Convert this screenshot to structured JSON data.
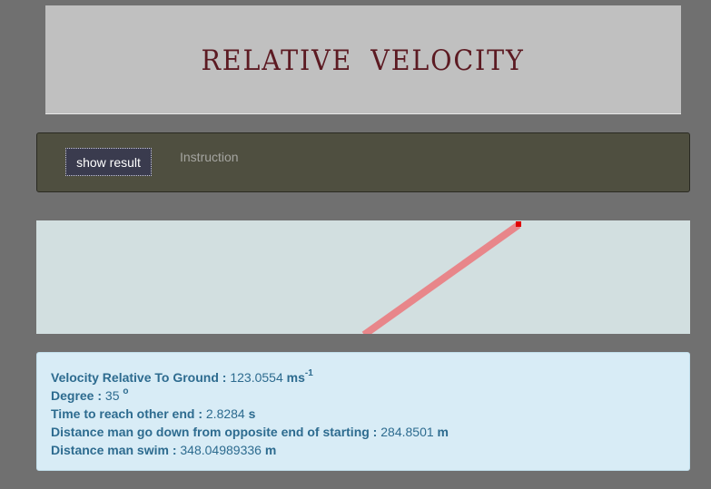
{
  "header": {
    "title": "RELATIVE  VELOCITY"
  },
  "controls": {
    "show_result_label": "show result",
    "instruction_label": "Instruction"
  },
  "simulation": {
    "path_color": "#e8868a",
    "marker_color": "#e00000"
  },
  "results": {
    "velocity": {
      "label": "Velocity Relative To Ground :",
      "value": "123.0554",
      "unit": "ms",
      "unit_sup": "-1"
    },
    "degree": {
      "label": "Degree :",
      "value": "35",
      "unit_sup": "o"
    },
    "time": {
      "label": "Time to reach other end :",
      "value": "2.8284",
      "unit": "s"
    },
    "distance_down": {
      "label": "Distance man go down from opposite end of starting :",
      "value": "284.8501",
      "unit": "m"
    },
    "distance_swim": {
      "label": "Distance man swim :",
      "value": "348.04989336",
      "unit": "m"
    }
  }
}
